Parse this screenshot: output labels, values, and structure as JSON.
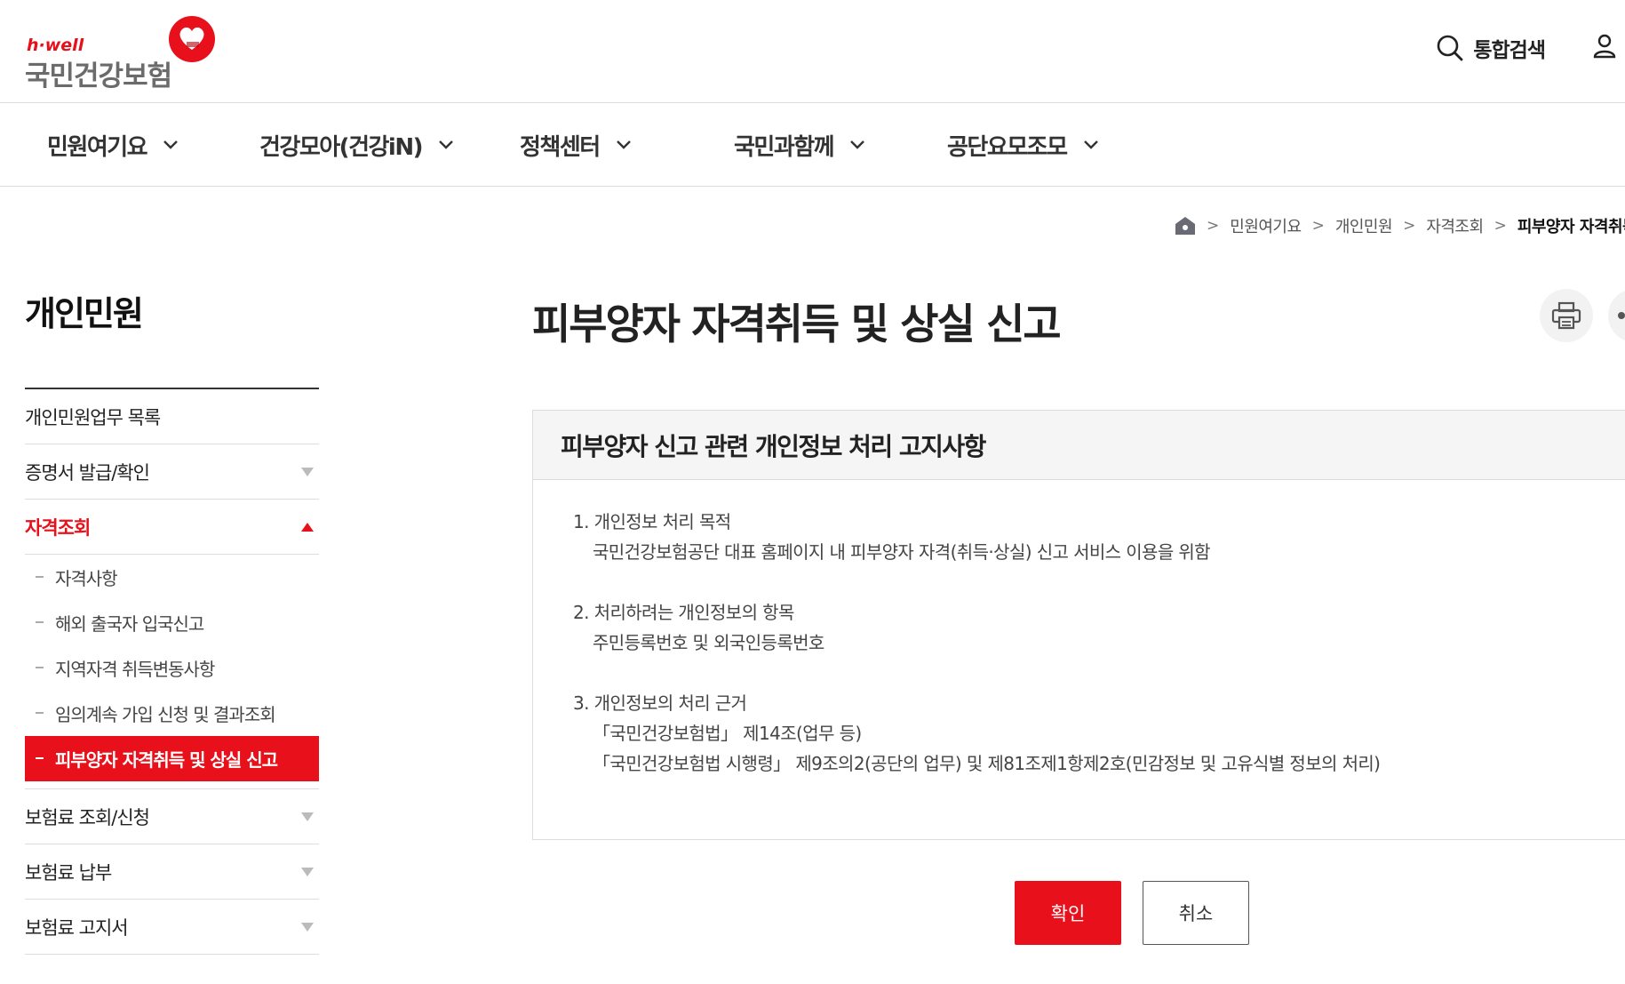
{
  "brand": {
    "tagline": "h·well",
    "name": "국민건강보험",
    "accent_color": "#e8101a"
  },
  "header": {
    "search_label": "통합검색",
    "search_icon": "search-icon",
    "user_icon": "user-icon"
  },
  "gnb": {
    "items": [
      {
        "label": "민원여기요"
      },
      {
        "label": "건강모아(건강iN)"
      },
      {
        "label": "정책센터"
      },
      {
        "label": "국민과함께"
      },
      {
        "label": "공단요모조모"
      }
    ]
  },
  "breadcrumb": {
    "home_icon": "home-icon",
    "items": [
      "민원여기요",
      "개인민원",
      "자격조회",
      "피부양자 자격취득 및 상실 신고"
    ]
  },
  "sidebar": {
    "title": "개인민원",
    "items": [
      {
        "label": "개인민원업무 목록"
      },
      {
        "label": "증명서 발급/확인"
      },
      {
        "label": "자격조회"
      },
      {
        "label": "보험료 조회/신청"
      },
      {
        "label": "보험료 납부"
      },
      {
        "label": "보험료 고지서"
      }
    ],
    "subitems": [
      {
        "label": "자격사항"
      },
      {
        "label": "해외 출국자 입국신고"
      },
      {
        "label": "지역자격 취득변동사항"
      },
      {
        "label": "임의계속 가입 신청 및 결과조회"
      },
      {
        "label": "피부양자 자격취득 및 상실 신고"
      }
    ]
  },
  "main": {
    "title": "피부양자 자격취득 및 상실 신고",
    "print_icon": "printer-icon",
    "notice": {
      "heading": "피부양자 신고 관련 개인정보 처리 고지사항",
      "sections": [
        {
          "title": "1. 개인정보 처리 목적",
          "lines": [
            "국민건강보험공단 대표 홈페이지 내 피부양자 자격(취득·상실) 신고 서비스 이용을 위함"
          ]
        },
        {
          "title": "2. 처리하려는 개인정보의 항목",
          "lines": [
            "주민등록번호 및 외국인등록번호"
          ]
        },
        {
          "title": "3. 개인정보의 처리 근거",
          "lines": [
            "「국민건강보험법」 제14조(업무 등)",
            "「국민건강보험법 시행령」 제9조의2(공단의 업무) 및 제81조제1항제2호(민감정보 및 고유식별 정보의 처리)"
          ]
        }
      ]
    },
    "confirm_label": "확인",
    "cancel_label": "취소"
  }
}
